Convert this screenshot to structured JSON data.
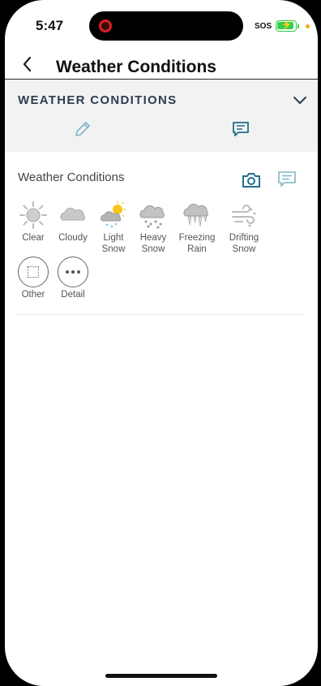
{
  "status": {
    "time": "5:47",
    "carrier": "SOS"
  },
  "nav": {
    "title": "Weather Conditions"
  },
  "section": {
    "title": "WEATHER CONDITIONS"
  },
  "card": {
    "title": "Weather Conditions"
  },
  "options": [
    {
      "id": "clear",
      "label": "Clear",
      "icon": "sun-icon"
    },
    {
      "id": "cloudy",
      "label": "Cloudy",
      "icon": "cloud-icon"
    },
    {
      "id": "light-snow",
      "label": "Light Snow",
      "icon": "sun-cloud-snow-icon"
    },
    {
      "id": "heavy-snow",
      "label": "Heavy Snow",
      "icon": "cloud-snow-icon"
    },
    {
      "id": "freezing-rain",
      "label": "Freezing Rain",
      "icon": "cloud-icicle-icon"
    },
    {
      "id": "drifting-snow",
      "label": "Drifting Snow",
      "icon": "wind-snow-icon"
    },
    {
      "id": "other",
      "label": "Other",
      "icon": "dotted-square-icon"
    },
    {
      "id": "detail",
      "label": "Detail",
      "icon": "more-dots-icon"
    }
  ],
  "colors": {
    "accent": "#1f6f8b",
    "pencil": "#7fb6c8",
    "section_bg": "#f2f2f2",
    "title": "#2c3e50"
  }
}
